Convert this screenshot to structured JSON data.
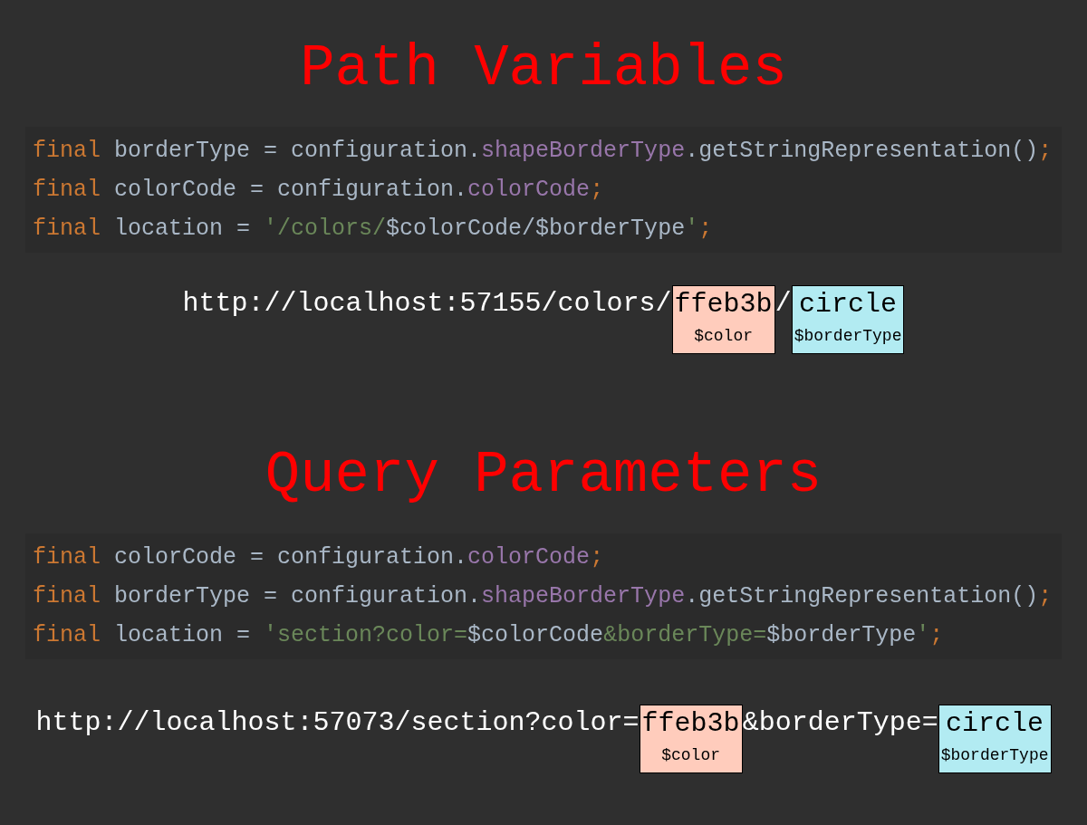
{
  "sections": [
    {
      "title": "Path Variables",
      "code_lines": [
        [
          {
            "text": "final",
            "kind": "keyword"
          },
          {
            "text": " borderType = configuration.",
            "kind": "ident"
          },
          {
            "text": "shapeBorderType",
            "kind": "field"
          },
          {
            "text": ".getStringRepresentation()",
            "kind": "ident"
          },
          {
            "text": ";",
            "kind": "keyword"
          }
        ],
        [
          {
            "text": "final",
            "kind": "keyword"
          },
          {
            "text": " colorCode = configuration.",
            "kind": "ident"
          },
          {
            "text": "colorCode",
            "kind": "field"
          },
          {
            "text": ";",
            "kind": "keyword"
          }
        ],
        [
          {
            "text": "final",
            "kind": "keyword"
          },
          {
            "text": " location = ",
            "kind": "ident"
          },
          {
            "text": "'/colors/",
            "kind": "string"
          },
          {
            "text": "$colorCode/$borderType",
            "kind": "ident"
          },
          {
            "text": "'",
            "kind": "string"
          },
          {
            "text": ";",
            "kind": "keyword"
          }
        ]
      ],
      "url": [
        {
          "text": "http://localhost:57155/colors/",
          "kind": "plain"
        },
        {
          "text": "ffeb3b",
          "kind": "param",
          "label": "$color",
          "color": "#ffccbc"
        },
        {
          "text": "/",
          "kind": "plain"
        },
        {
          "text": "circle",
          "kind": "param",
          "label": "$borderType",
          "color": "#b2ebf2"
        }
      ]
    },
    {
      "title": "Query Parameters",
      "code_lines": [
        [
          {
            "text": "final",
            "kind": "keyword"
          },
          {
            "text": " colorCode = configuration.",
            "kind": "ident"
          },
          {
            "text": "colorCode",
            "kind": "field"
          },
          {
            "text": ";",
            "kind": "keyword"
          }
        ],
        [
          {
            "text": "final",
            "kind": "keyword"
          },
          {
            "text": " borderType = configuration.",
            "kind": "ident"
          },
          {
            "text": "shapeBorderType",
            "kind": "field"
          },
          {
            "text": ".getStringRepresentation()",
            "kind": "ident"
          },
          {
            "text": ";",
            "kind": "keyword"
          }
        ],
        [
          {
            "text": "final",
            "kind": "keyword"
          },
          {
            "text": " location = ",
            "kind": "ident"
          },
          {
            "text": "'section?color=",
            "kind": "string"
          },
          {
            "text": "$colorCode",
            "kind": "ident"
          },
          {
            "text": "&borderType=",
            "kind": "string"
          },
          {
            "text": "$borderType",
            "kind": "ident"
          },
          {
            "text": "'",
            "kind": "string"
          },
          {
            "text": ";",
            "kind": "keyword"
          }
        ]
      ],
      "url": [
        {
          "text": "http://localhost:57073/section?color=",
          "kind": "plain"
        },
        {
          "text": "ffeb3b",
          "kind": "param",
          "label": "$color",
          "color": "#ffccbc"
        },
        {
          "text": "&borderType=",
          "kind": "plain"
        },
        {
          "text": "circle",
          "kind": "param",
          "label": "$borderType",
          "color": "#b2ebf2"
        }
      ]
    }
  ]
}
